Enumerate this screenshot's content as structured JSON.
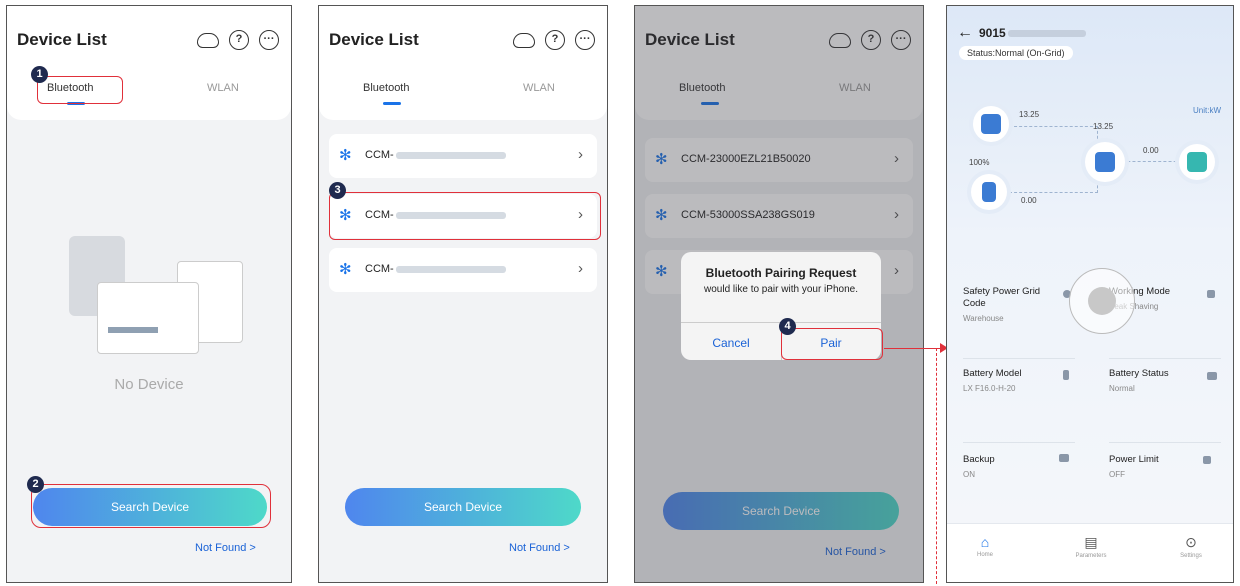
{
  "phone1": {
    "title": "Device List",
    "tabs": [
      "Bluetooth",
      "WLAN"
    ],
    "empty_text": "No Device",
    "search_button": "Search Device",
    "not_found": "Not Found >",
    "steps": [
      "1",
      "2"
    ]
  },
  "phone2": {
    "title": "Device List",
    "tabs": [
      "Bluetooth",
      "WLAN"
    ],
    "devices": [
      "CCM-",
      "CCM-",
      "CCM-"
    ],
    "search_button": "Search Device",
    "not_found": "Not Found >",
    "step": "3"
  },
  "phone3": {
    "title": "Device List",
    "tabs": [
      "Bluetooth",
      "WLAN"
    ],
    "devices": [
      "CCM-23000EZL21B50020",
      "CCM-53000SSA238GS019",
      ""
    ],
    "dialog": {
      "title": "Bluetooth Pairing Request",
      "message": "would like to pair with your iPhone.",
      "cancel": "Cancel",
      "pair": "Pair"
    },
    "search_button": "Search Device",
    "not_found": "Not Found >",
    "step": "4"
  },
  "phone4": {
    "sn_prefix": "9015",
    "status": "Status:Normal (On-Grid)",
    "unit": "Unit:kW",
    "flow_values": {
      "pv": "13.25",
      "load": "13.25",
      "grid": "0.00",
      "battery_soc": "100%",
      "battery": "0.00"
    },
    "cards": [
      {
        "key": "Safety Power Grid Code",
        "value": "Warehouse"
      },
      {
        "key": "Working Mode",
        "value": "Peak Shaving"
      },
      {
        "key": "Battery Model",
        "value": "LX F16.0-H-20"
      },
      {
        "key": "Battery Status",
        "value": "Normal"
      },
      {
        "key": "Backup",
        "value": "ON"
      },
      {
        "key": "Power Limit",
        "value": "OFF"
      }
    ],
    "nav": [
      "Home",
      "Parameters",
      "Settings"
    ]
  },
  "colors": {
    "accent": "#1a73e8",
    "highlight": "#e0303a",
    "badge": "#1f2a4f"
  }
}
